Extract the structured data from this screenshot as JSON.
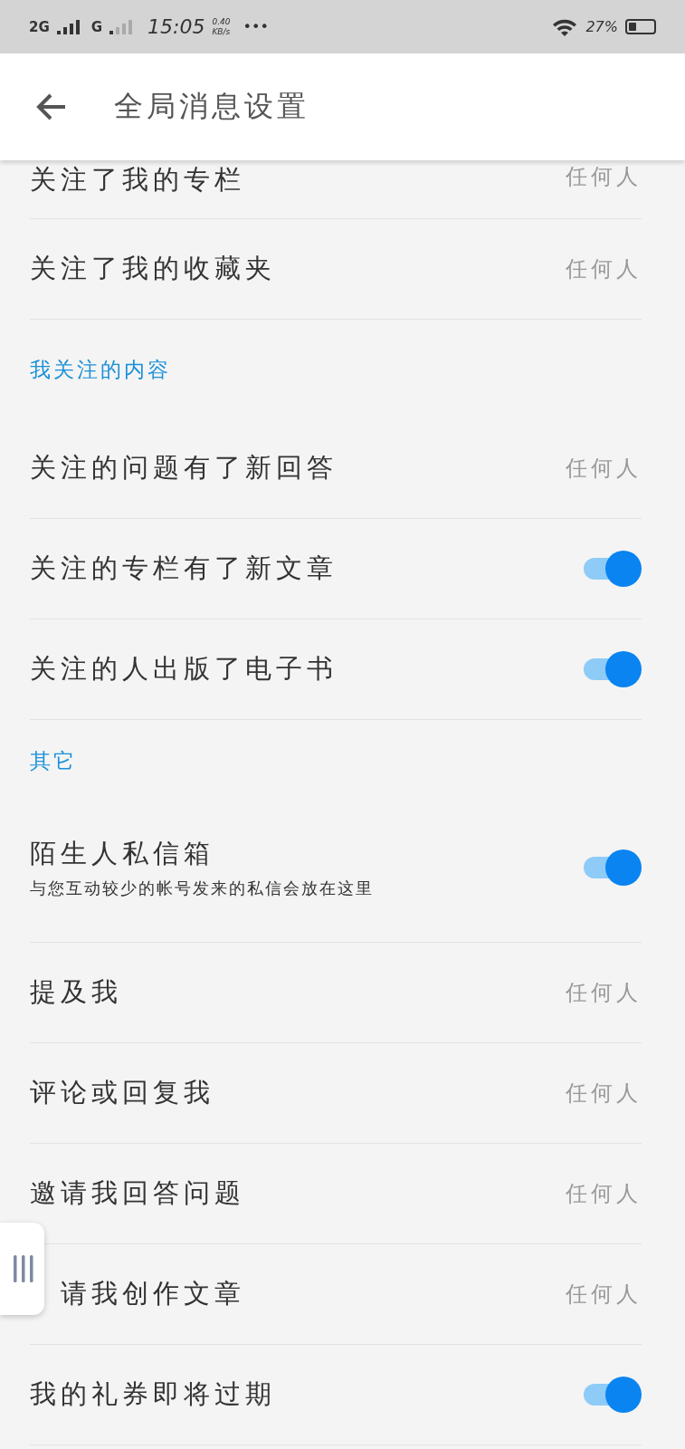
{
  "status_bar": {
    "network_1": "2G",
    "network_2": "G",
    "time": "15:05",
    "speed": "0.40",
    "speed_unit": "KB/s",
    "more": "•••",
    "battery": "27%"
  },
  "header": {
    "title": "全局消息设置"
  },
  "sections": [
    {
      "items": [
        {
          "kind": "value",
          "label": "关注了我的专栏",
          "value": "任何人",
          "partial": true
        },
        {
          "kind": "value",
          "label": "关注了我的收藏夹",
          "value": "任何人"
        }
      ]
    },
    {
      "title": "我关注的内容",
      "items": [
        {
          "kind": "value",
          "label": "关注的问题有了新回答",
          "value": "任何人"
        },
        {
          "kind": "toggle",
          "label": "关注的专栏有了新文章",
          "on": true
        },
        {
          "kind": "toggle",
          "label": "关注的人出版了电子书",
          "on": true
        }
      ]
    },
    {
      "title": "其它",
      "items": [
        {
          "kind": "toggle",
          "label": "陌生人私信箱",
          "description": "与您互动较少的帐号发来的私信会放在这里",
          "on": true
        },
        {
          "kind": "value",
          "label": "提及我",
          "value": "任何人"
        },
        {
          "kind": "value",
          "label": "评论或回复我",
          "value": "任何人"
        },
        {
          "kind": "value",
          "label": "邀请我回答问题",
          "value": "任何人"
        },
        {
          "kind": "value",
          "label": "请我创作文章",
          "value": "任何人",
          "covered": true
        },
        {
          "kind": "toggle",
          "label": "我的礼券即将过期",
          "on": true
        }
      ]
    }
  ]
}
